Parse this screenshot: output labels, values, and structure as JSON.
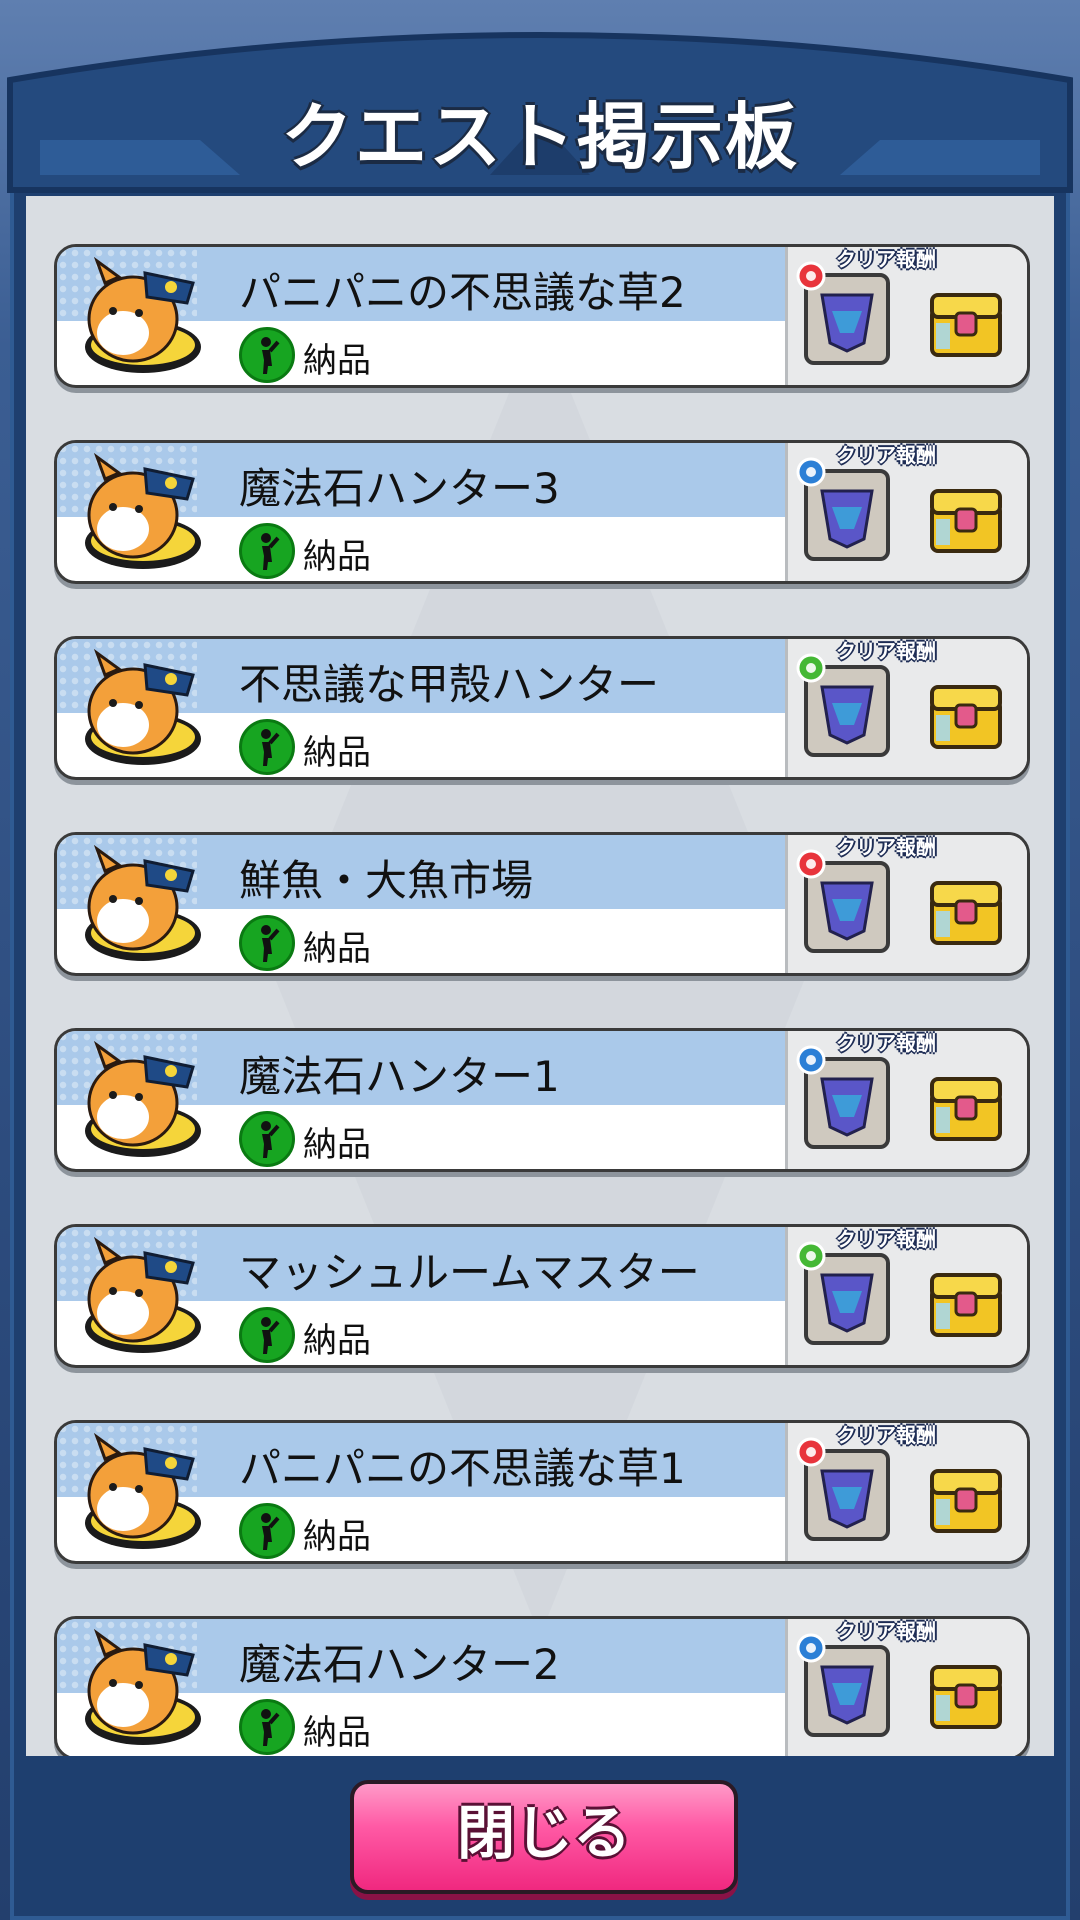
{
  "header": {
    "title": "クエスト掲示板"
  },
  "reward_label": "クリア報酬",
  "quests": [
    {
      "name": "パニパニの不思議な草2",
      "type": "納品",
      "element": "fire"
    },
    {
      "name": "魔法石ハンター3",
      "type": "納品",
      "element": "water"
    },
    {
      "name": "不思議な甲殻ハンター",
      "type": "納品",
      "element": "wood"
    },
    {
      "name": "鮮魚・大魚市場",
      "type": "納品",
      "element": "fire"
    },
    {
      "name": "魔法石ハンター1",
      "type": "納品",
      "element": "water"
    },
    {
      "name": "マッシュルームマスター",
      "type": "納品",
      "element": "wood"
    },
    {
      "name": "パニパニの不思議な草1",
      "type": "納品",
      "element": "fire"
    },
    {
      "name": "魔法石ハンター2",
      "type": "納品",
      "element": "water"
    }
  ],
  "element_colors": {
    "fire": "#e8343c",
    "water": "#2b7fd6",
    "wood": "#45b835"
  },
  "footer": {
    "close_label": "閉じる"
  }
}
